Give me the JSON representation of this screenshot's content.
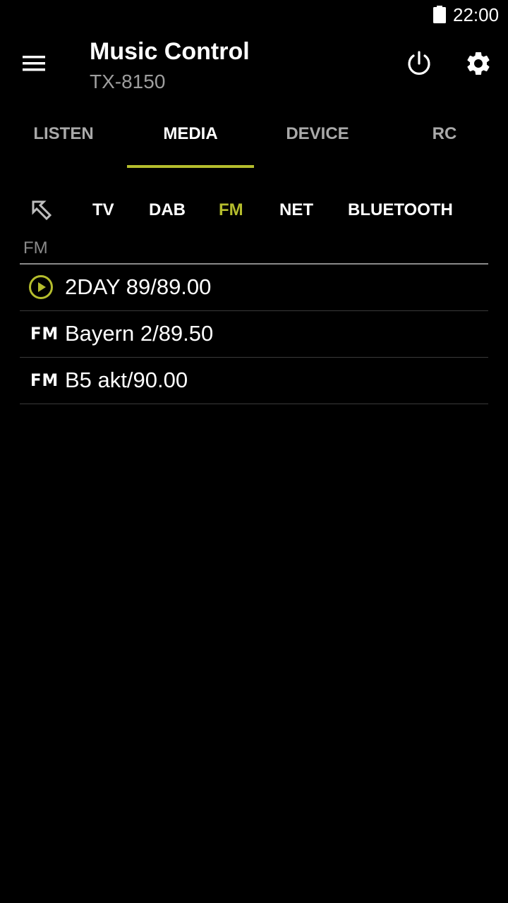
{
  "status_bar": {
    "time": "22:00",
    "battery_icon": "battery-full-icon"
  },
  "app_bar": {
    "title": "Music Control",
    "subtitle": "TX-8150",
    "menu_icon": "hamburger-menu-icon",
    "power_icon": "power-icon",
    "settings_icon": "gear-icon"
  },
  "tabs": [
    {
      "label": "LISTEN",
      "active": false
    },
    {
      "label": "MEDIA",
      "active": true
    },
    {
      "label": "DEVICE",
      "active": false
    },
    {
      "label": "RC",
      "active": false
    }
  ],
  "sources": {
    "back_icon": "arrow-up-left-icon",
    "items": [
      {
        "label": "TV",
        "active": false
      },
      {
        "label": "DAB",
        "active": false
      },
      {
        "label": "FM",
        "active": true
      },
      {
        "label": "NET",
        "active": false
      },
      {
        "label": "BLUETOOTH",
        "active": false
      }
    ]
  },
  "section": {
    "label": "FM"
  },
  "stations": [
    {
      "name": "2DAY 89/89.00",
      "icon": "play-circle-icon",
      "playing": true
    },
    {
      "name": "Bayern 2/89.50",
      "icon_text": "FM",
      "playing": false
    },
    {
      "name": "B5 akt/90.00",
      "icon_text": "FM",
      "playing": false
    }
  ],
  "colors": {
    "accent": "#b5bd2d",
    "background": "#000000",
    "inactive_text": "#a9a9a9"
  }
}
